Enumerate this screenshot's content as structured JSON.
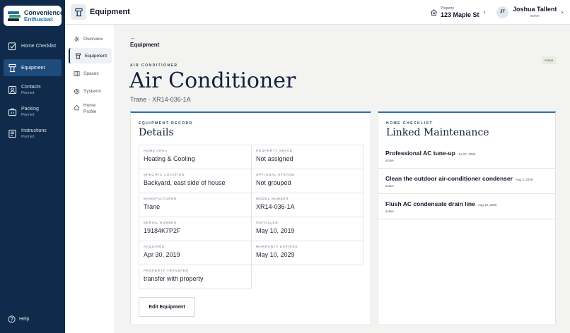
{
  "brand": {
    "line1": "Convenience",
    "line2": "Enthusiast"
  },
  "sidebar": {
    "items": [
      {
        "label": "Home Checklist",
        "sub": ""
      },
      {
        "label": "Equipment",
        "sub": ""
      },
      {
        "label": "Contacts",
        "sub": "Planned"
      },
      {
        "label": "Packing",
        "sub": "Planned"
      },
      {
        "label": "Instructions",
        "sub": "Planned"
      }
    ],
    "help_label": "Help"
  },
  "header": {
    "title": "Equipment",
    "property_label": "Property",
    "property_name": "123 Maple St",
    "user_initials": "JT",
    "user_name": "Joshua Tallent",
    "user_role": "owner"
  },
  "subnav": {
    "items": [
      {
        "label": "Overview"
      },
      {
        "label": "Equipment"
      },
      {
        "label": "Spaces"
      },
      {
        "label": "Systems"
      },
      {
        "label": "Home",
        "label2": "Profile"
      }
    ]
  },
  "main": {
    "back_arrow": "←",
    "breadcrumb": "Equipment",
    "status": "Active",
    "eyebrow": "AIR CONDITIONER",
    "title": "Air Conditioner",
    "subtitle": "Trane · XR14-036-1A"
  },
  "details": {
    "eyebrow": "EQUIPMENT RECORD",
    "title": "Details",
    "fields": [
      {
        "key": "Home area",
        "value": "Heating & Cooling"
      },
      {
        "key": "Property space",
        "value": "Not assigned"
      },
      {
        "key": "Specific location",
        "value": "Backyard, east side of house"
      },
      {
        "key": "Optional system",
        "value": "Not grouped"
      },
      {
        "key": "Manufacturer",
        "value": "Trane"
      },
      {
        "key": "Model number",
        "value": "XR14-036-1A"
      },
      {
        "key": "Serial number",
        "value": "19184K7P2F"
      },
      {
        "key": "Installed",
        "value": "May 10, 2019"
      },
      {
        "key": "Acquired",
        "value": "Apr 30, 2019"
      },
      {
        "key": "Warranty expires",
        "value": "May 10, 2029"
      },
      {
        "key": "Property transfer",
        "value": "transfer with property"
      }
    ],
    "edit_label": "Edit Equipment"
  },
  "maintenance": {
    "eyebrow": "HOME CHECKLIST",
    "title": "Linked Maintenance",
    "items": [
      {
        "title": "Professional AC tune-up",
        "date": "Jul 27, 2026",
        "status": "active"
      },
      {
        "title": "Clean the outdoor air-conditioner condenser",
        "date": "Aug 3, 2026",
        "status": "active"
      },
      {
        "title": "Flush AC condensate drain line",
        "date": "Aug 10, 2026",
        "status": "active"
      }
    ]
  },
  "colors": {
    "sidebar_bg": "#0f2a4a",
    "sidebar_active": "#1e4a7c",
    "accent": "#2f6ea5"
  }
}
